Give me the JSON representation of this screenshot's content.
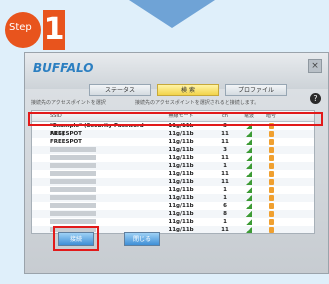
{
  "step": {
    "word": "Step",
    "number": "1"
  },
  "window": {
    "brand": "BUFFALO",
    "close": "×"
  },
  "tabs": [
    {
      "label": "ステータス"
    },
    {
      "label": "検 索"
    },
    {
      "label": "プロファイル"
    }
  ],
  "info": {
    "left": "接続先のアクセスポイントを選択",
    "mid": "接続先のアクセスポイントを選択されると接続します。",
    "help": "?"
  },
  "columns": [
    "SSID",
    "無線モード",
    "ch",
    "電波",
    "暗号"
  ],
  "rows": [
    {
      "ssid": "\"Example\" (Security Password AES)",
      "mode": "11g/11b",
      "ch": "3",
      "blurred": false
    },
    {
      "ssid": "FREESPOT",
      "mode": "11g/11b",
      "ch": "11",
      "blurred": false
    },
    {
      "ssid": "FREESPOT",
      "mode": "11g/11b",
      "ch": "11",
      "blurred": false
    },
    {
      "ssid": "",
      "mode": "11g/11b",
      "ch": "3",
      "blurred": true
    },
    {
      "ssid": "",
      "mode": "11g/11b",
      "ch": "11",
      "blurred": true
    },
    {
      "ssid": "",
      "mode": "11g/11b",
      "ch": "1",
      "blurred": true
    },
    {
      "ssid": "",
      "mode": "11g/11b",
      "ch": "11",
      "blurred": true
    },
    {
      "ssid": "",
      "mode": "11g/11b",
      "ch": "11",
      "blurred": true
    },
    {
      "ssid": "",
      "mode": "11g/11b",
      "ch": "1",
      "blurred": true
    },
    {
      "ssid": "",
      "mode": "11g/11b",
      "ch": "1",
      "blurred": true
    },
    {
      "ssid": "",
      "mode": "11g/11b",
      "ch": "6",
      "blurred": true
    },
    {
      "ssid": "",
      "mode": "11g/11b",
      "ch": "8",
      "blurred": true
    },
    {
      "ssid": "",
      "mode": "11g/11b",
      "ch": "1",
      "blurred": true
    },
    {
      "ssid": "",
      "mode": "11g/11b",
      "ch": "11",
      "blurred": true
    },
    {
      "ssid": "",
      "mode": "11g/11b",
      "ch": "11",
      "blurred": true
    }
  ],
  "buttons": {
    "connect": "接続",
    "cancel": "閉じる"
  }
}
